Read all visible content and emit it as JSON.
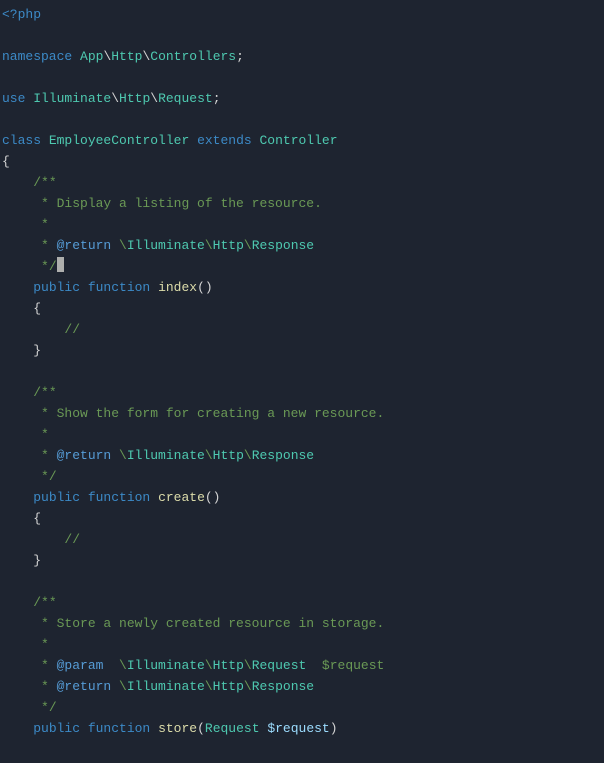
{
  "colors": {
    "background": "#1e2430",
    "keyword": "#3c8ac7",
    "type": "#4ec9b0",
    "comment": "#6a9955",
    "annotation": "#569cd6",
    "function": "#dcdcaa",
    "variable": "#9cdcfe",
    "plain": "#d4d4d4"
  },
  "code": {
    "open_tag": "<?php",
    "ns_kw": "namespace",
    "ns_path": [
      "App",
      "Http",
      "Controllers"
    ],
    "use_kw": "use",
    "use_path": [
      "Illuminate",
      "Http",
      "Request"
    ],
    "class_kw": "class",
    "class_name": "EmployeeController",
    "extends_kw": "extends",
    "parent": "Controller",
    "brace_open": "{",
    "brace_close": "}",
    "doc1": {
      "open": "/**",
      "l1": " * Display a listing of the resource.",
      "l2": " *",
      "l3_star": " * ",
      "l3_ann": "@return",
      "l3_path_pre": " \\",
      "l3_path": [
        "Illuminate",
        "Http",
        "Response"
      ],
      "close": " */"
    },
    "fn1": {
      "mods": "public function",
      "name": "index",
      "params": "()",
      "body_comment": "//"
    },
    "doc2": {
      "open": "/**",
      "l1": " * Show the form for creating a new resource.",
      "l2": " *",
      "l3_star": " * ",
      "l3_ann": "@return",
      "l3_path_pre": " \\",
      "l3_path": [
        "Illuminate",
        "Http",
        "Response"
      ],
      "close": " */"
    },
    "fn2": {
      "mods": "public function",
      "name": "create",
      "params": "()",
      "body_comment": "//"
    },
    "doc3": {
      "open": "/**",
      "l1": " * Store a newly created resource in storage.",
      "l2": " *",
      "l3_star": " * ",
      "l3_ann": "@param",
      "l3_path_pre": "  \\",
      "l3_path": [
        "Illuminate",
        "Http",
        "Request"
      ],
      "l3_after": "  $request",
      "l4_star": " * ",
      "l4_ann": "@return",
      "l4_path_pre": " \\",
      "l4_path": [
        "Illuminate",
        "Http",
        "Response"
      ],
      "close": " */"
    },
    "fn3": {
      "mods": "public function",
      "name": "store",
      "param_open": "(",
      "param_type": "Request",
      "param_space": " ",
      "param_var": "$request",
      "param_close": ")"
    },
    "semi": ";",
    "slash": "\\",
    "space": " "
  }
}
